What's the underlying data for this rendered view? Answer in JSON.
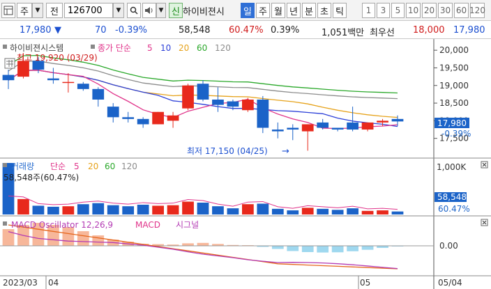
{
  "toolbar": {
    "market_label": "주",
    "jeon_label": "전",
    "stock_code": "126700",
    "new_badge": "신",
    "stock_name": "하이비젼시",
    "period_tabs": [
      "일",
      "주",
      "월",
      "년",
      "분",
      "초",
      "틱"
    ],
    "selected_period": "일",
    "interval_tabs": [
      "1",
      "3",
      "5",
      "10",
      "20",
      "30",
      "60",
      "120"
    ]
  },
  "quote": {
    "price": "17,980",
    "change": "70",
    "change_pct": "-0.39%",
    "volume": "58,548",
    "volume_ratio": "60.47%",
    "turnover": "0.39%",
    "amount": "1,051백만",
    "best_ask_label": "최우선",
    "best_ask": "18,000",
    "best_bid": "17,980"
  },
  "price_panel": {
    "title": "하이비젼시스템",
    "ma_label": "종가 단순",
    "ma_periods": [
      "5",
      "10",
      "20",
      "60",
      "120"
    ],
    "high_annotation": "최고 19,920 (03/29)",
    "low_annotation": "최저 17,150 (04/25)",
    "last_price": "17,980",
    "last_change": "-0.39%",
    "y_ticks": [
      "20,000",
      "19,500",
      "19,000",
      "18,500",
      "18,000",
      "17,500"
    ]
  },
  "volume_panel": {
    "title": "거래량",
    "ma_label": "단순",
    "ma_periods": [
      "5",
      "20",
      "60",
      "120"
    ],
    "volume_text": "58,548주(60.47%)",
    "last_volume": "58,548",
    "last_ratio": "60.47%",
    "y_tick": "1,000K"
  },
  "macd_panel": {
    "osc_label": "MACD Oscillator 12,26,9",
    "macd_label": "MACD",
    "signal_label": "시그널",
    "y_tick": "0.00"
  },
  "x_axis": {
    "labels": [
      "2023/03",
      "04",
      "05",
      "05/04"
    ]
  },
  "colors": {
    "up": "#e8291c",
    "down": "#1b63c8",
    "ma5": "#e0338a",
    "ma10": "#2b3fd8",
    "ma20": "#e6a21a",
    "ma60": "#2aa82a",
    "ma120": "#8c8c8c",
    "osc_pos": "#f7b79a",
    "osc_neg": "#9fd8ef"
  },
  "chart_data": {
    "type": "candlestick",
    "candles": [
      {
        "o": 19300,
        "h": 19450,
        "l": 18900,
        "c": 19150
      },
      {
        "o": 19250,
        "h": 19920,
        "l": 19200,
        "c": 19700
      },
      {
        "o": 19700,
        "h": 19800,
        "l": 19350,
        "c": 19450
      },
      {
        "o": 19200,
        "h": 19500,
        "l": 19050,
        "c": 19150
      },
      {
        "o": 19100,
        "h": 19350,
        "l": 18800,
        "c": 19100
      },
      {
        "o": 19050,
        "h": 19100,
        "l": 18850,
        "c": 18900
      },
      {
        "o": 18900,
        "h": 18950,
        "l": 18400,
        "c": 18600
      },
      {
        "o": 18400,
        "h": 18500,
        "l": 17950,
        "c": 18100
      },
      {
        "o": 18100,
        "h": 18250,
        "l": 17950,
        "c": 18050
      },
      {
        "o": 18050,
        "h": 18100,
        "l": 17800,
        "c": 17900
      },
      {
        "o": 17900,
        "h": 18250,
        "l": 17900,
        "c": 18250
      },
      {
        "o": 18000,
        "h": 18250,
        "l": 17800,
        "c": 18150
      },
      {
        "o": 18350,
        "h": 19050,
        "l": 18300,
        "c": 19000
      },
      {
        "o": 19050,
        "h": 19150,
        "l": 18550,
        "c": 18600
      },
      {
        "o": 18600,
        "h": 18950,
        "l": 18250,
        "c": 18450
      },
      {
        "o": 18550,
        "h": 18600,
        "l": 18300,
        "c": 18400
      },
      {
        "o": 18300,
        "h": 18650,
        "l": 18250,
        "c": 18600
      },
      {
        "o": 18600,
        "h": 18700,
        "l": 17650,
        "c": 17800
      },
      {
        "o": 17750,
        "h": 17950,
        "l": 17500,
        "c": 17700
      },
      {
        "o": 17800,
        "h": 17900,
        "l": 17450,
        "c": 17750
      },
      {
        "o": 17700,
        "h": 17900,
        "l": 17150,
        "c": 17900
      },
      {
        "o": 17950,
        "h": 18050,
        "l": 17750,
        "c": 17800
      },
      {
        "o": 17800,
        "h": 17800,
        "l": 17700,
        "c": 17750
      },
      {
        "o": 17950,
        "h": 18400,
        "l": 17700,
        "c": 17750
      },
      {
        "o": 17750,
        "h": 17950,
        "l": 17700,
        "c": 17950
      },
      {
        "o": 17950,
        "h": 18050,
        "l": 17850,
        "c": 18000
      },
      {
        "o": 18050,
        "h": 18150,
        "l": 17850,
        "c": 17980
      }
    ],
    "volume": [
      1000,
      300,
      170,
      150,
      160,
      200,
      220,
      180,
      160,
      190,
      170,
      180,
      250,
      230,
      160,
      120,
      200,
      210,
      110,
      80,
      130,
      110,
      90,
      120,
      70,
      80,
      58.5
    ],
    "oscillator": [
      8,
      10,
      11,
      10,
      9,
      7,
      5,
      3,
      2,
      1,
      0.8,
      0.6,
      1.2,
      1.4,
      0.9,
      0.4,
      0.3,
      -0.5,
      -1.5,
      -2.5,
      -3.0,
      -3.2,
      -3.1,
      -2.6,
      -1.9,
      -1.0,
      -0.3
    ],
    "ylim": [
      17000,
      20200
    ]
  }
}
